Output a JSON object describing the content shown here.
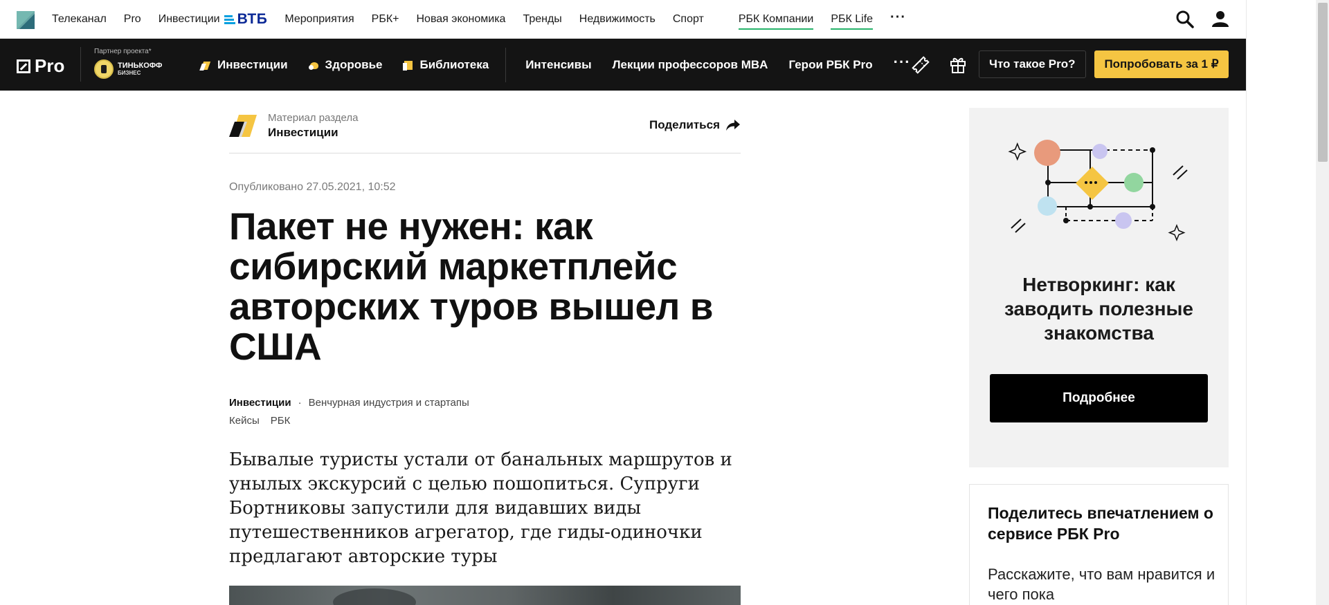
{
  "topnav": {
    "items": [
      "Телеканал",
      "Pro",
      "Инвестиции"
    ],
    "vtb_label": "ВТБ",
    "items2": [
      "Мероприятия",
      "РБК+",
      "Новая экономика",
      "Тренды",
      "Недвижимость",
      "Спорт"
    ],
    "highlight": [
      "РБК Компании",
      "РБК Life"
    ],
    "more": "···"
  },
  "probar": {
    "logo": "Pro",
    "partner_label": "Партнер проекта*",
    "partner_name": "ТИНЬКОФФ",
    "partner_sub": "БИЗНЕС",
    "sections": [
      "Инвестиции",
      "Здоровье",
      "Библиотека"
    ],
    "links": [
      "Интенсивы",
      "Лекции профессоров MBA",
      "Герои РБК Pro"
    ],
    "more": "···",
    "what_label": "Что такое Pro?",
    "try_label": "Попробовать за 1 ₽"
  },
  "article": {
    "section_label": "Материал раздела",
    "section_name": "Инвестиции",
    "share": "Поделиться",
    "published": "Опубликовано 27.05.2021, 10:52",
    "title": "Пакет не нужен: как сибирский маркетплейс авторских туров вышел в США",
    "tag_main": "Инвестиции",
    "tag_dot": "·",
    "tag_sub": "Венчурная индустрия и стартапы",
    "tags": [
      "Кейсы",
      "РБК"
    ],
    "lead": "Бывалые туристы устали от банальных маршрутов и унылых экскурсий с целью пошопиться. Супруги Бортниковы запустили для видавших виды путешественников агрегатор, где гиды-одиночки предлагают авторские туры"
  },
  "sidebar": {
    "promo_title": "Нетворкинг: как заводить полезные знакомства",
    "promo_button": "Подробнее",
    "feedback_title": "Поделитесь впечатлением о сервисе РБК Pro",
    "feedback_text": "Расскажите, что вам нравится и чего пока"
  },
  "colors": {
    "accent_yellow": "#f5c542",
    "dark": "#141414",
    "green_underline": "#26b36a",
    "vtb_blue": "#0a2896"
  },
  "icons": [
    "rbc-logo-icon",
    "search-icon",
    "user-icon",
    "ticket-icon",
    "gift-icon",
    "share-arrow-icon",
    "section-logo-icon"
  ]
}
